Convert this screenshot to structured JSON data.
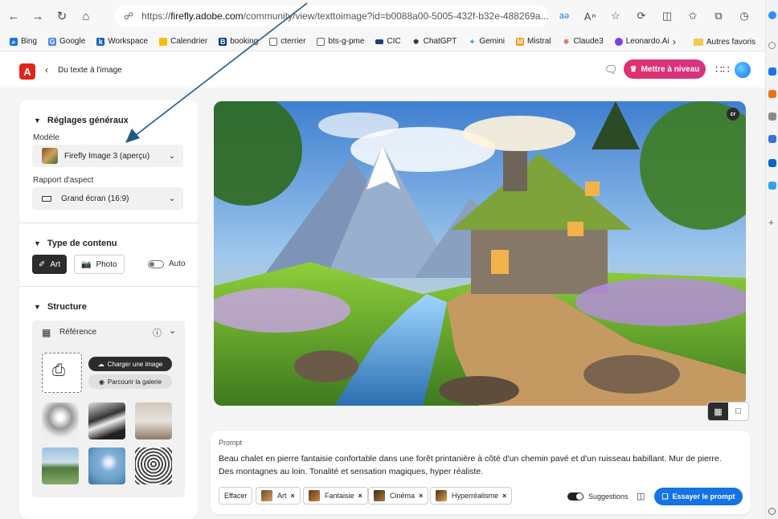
{
  "browser": {
    "url_prefix": "https://",
    "url_domain": "firefly.adobe.com",
    "url_path": "/community/view/texttoimage?id=b0088a00-5005-432f-b32e-488269a...",
    "toolbar_text": "aə",
    "bookmarks": [
      {
        "label": "Bing",
        "icon": "search-icon",
        "color": "#1a73e8"
      },
      {
        "label": "Google",
        "icon": "google-icon",
        "color": "#4285f4"
      },
      {
        "label": "Workspace",
        "icon": "k-icon",
        "color": "#1565c0"
      },
      {
        "label": "Calendrier",
        "icon": "calendar-icon",
        "color": "#fbbc04"
      },
      {
        "label": "booking",
        "icon": "booking-icon",
        "color": "#003580"
      },
      {
        "label": "cterrier",
        "icon": "page-icon",
        "color": "#666666"
      },
      {
        "label": "bts-g-pme",
        "icon": "page-icon",
        "color": "#666666"
      },
      {
        "label": "CIC",
        "icon": "bank-icon",
        "color": "#1a3d7c"
      },
      {
        "label": "ChatGPT",
        "icon": "chatgpt-icon",
        "color": "#333333"
      },
      {
        "label": "Gemini",
        "icon": "gemini-icon",
        "color": "#4c8df6"
      },
      {
        "label": "Mistral",
        "icon": "mistral-icon",
        "color": "#f7931e"
      },
      {
        "label": "Claude3",
        "icon": "claude-icon",
        "color": "#d97757"
      },
      {
        "label": "Leonardo.Ai",
        "icon": "leonardo-icon",
        "color": "#7b3fe4"
      }
    ],
    "other_bookmarks": "Autres favoris"
  },
  "header": {
    "back_label": "Du texte à l'image",
    "upgrade_label": "Mettre à niveau"
  },
  "panel": {
    "general_title": "Réglages généraux",
    "model_label": "Modèle",
    "model_value": "Firefly Image 3 (aperçu)",
    "aspect_label": "Rapport d'aspect",
    "aspect_value": "Grand écran (16:9)",
    "content_title": "Type de contenu",
    "art_label": "Art",
    "photo_label": "Photo",
    "auto_label": "Auto",
    "auto_enabled": false,
    "structure_title": "Structure",
    "reference_label": "Référence",
    "upload_label": "Charger une image",
    "gallery_label": "Parcourir la galerie"
  },
  "image": {
    "badge": "cr"
  },
  "prompt": {
    "label": "Prompt",
    "text": "Beau chalet en pierre fantaisie confortable dans une forêt printanière à côté d'un chemin pavé et d'un ruisseau babillant. Mur de pierre. Des montagnes au loin. Tonalité et sensation magiques, hyper réaliste.",
    "clear_label": "Effacer",
    "tags": [
      "Art",
      "Fantaisie",
      "Cinéma",
      "Hyperréalisme"
    ],
    "suggestions_label": "Suggestions",
    "suggestions_enabled": true,
    "try_label": "Essayer le prompt"
  },
  "colors": {
    "accent_blue": "#1473e6",
    "upgrade_pink": "#e1306c",
    "adobe_red": "#e1251b"
  }
}
